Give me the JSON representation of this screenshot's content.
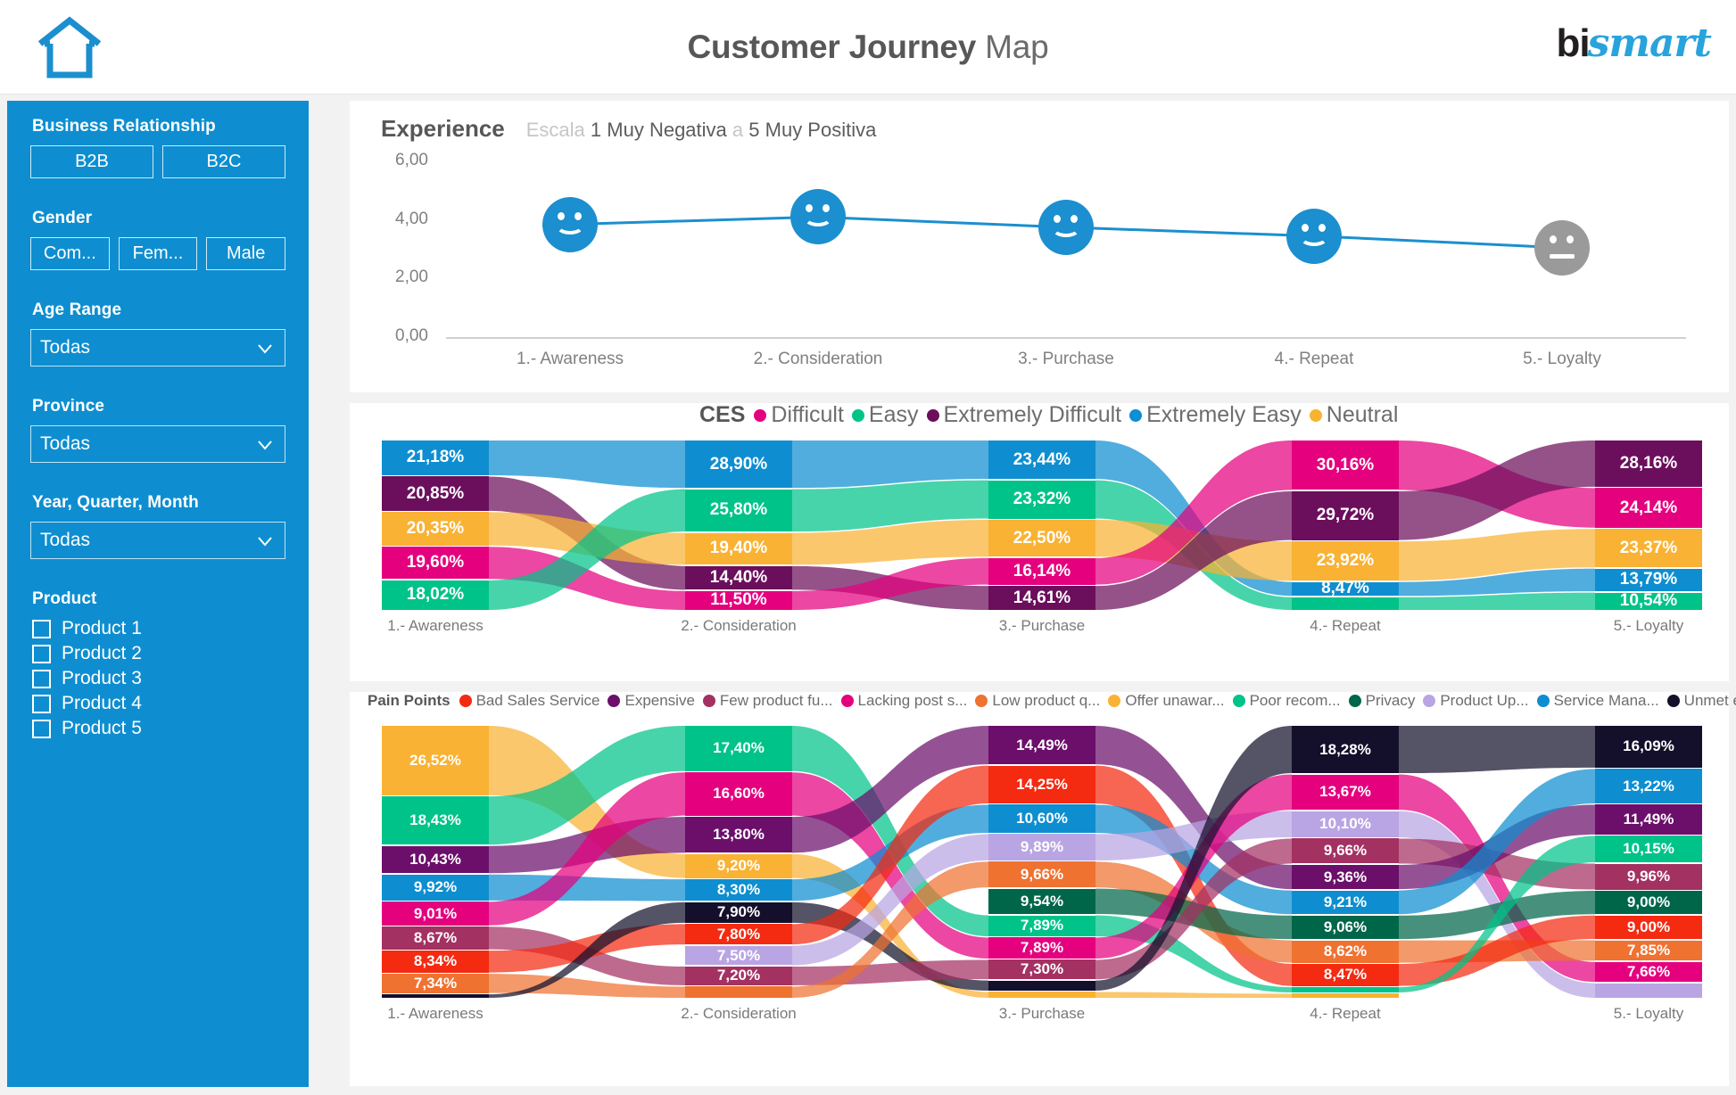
{
  "header": {
    "title_bold": "Customer Journey",
    "title_light": "Map",
    "home_icon": "home-icon",
    "logo_bi": "bi",
    "logo_smart": "smart"
  },
  "sidebar": {
    "business_relationship": {
      "label": "Business Relationship",
      "options": [
        "B2B",
        "B2C"
      ]
    },
    "gender": {
      "label": "Gender",
      "options": [
        "Com...",
        "Fem...",
        "Male"
      ]
    },
    "age_range": {
      "label": "Age Range",
      "value": "Todas",
      "chevron": "chevron-down-icon"
    },
    "province": {
      "label": "Province",
      "value": "Todas",
      "chevron": "chevron-down-icon"
    },
    "year_quarter_month": {
      "label": "Year, Quarter, Month",
      "value": "Todas",
      "chevron": "chevron-down-icon"
    },
    "product": {
      "label": "Product",
      "options": [
        "Product 1",
        "Product 2",
        "Product 3",
        "Product 4",
        "Product 5"
      ]
    }
  },
  "experience_card": {
    "title": "Experience",
    "sub_dim1": "Escala",
    "sub_1": "1 Muy Negativa",
    "sub_dim2": "a",
    "sub_2": "5 Muy Positiva"
  },
  "ces_card": {
    "legend_title": "CES"
  },
  "pain_card": {
    "legend_title": "Pain Points"
  },
  "chart_data": [
    {
      "type": "line",
      "title": "Experience",
      "subtitle": "Escala 1 Muy Negativa a 5 Muy Positiva",
      "categories": [
        "1.- Awareness",
        "2.- Consideration",
        "3.- Purchase",
        "4.- Repeat",
        "5.- Loyalty"
      ],
      "values": [
        3.85,
        4.1,
        3.75,
        3.45,
        3.05
      ],
      "ylim": [
        0,
        6
      ],
      "yticks": [
        "0,00",
        "2,00",
        "4,00",
        "6,00"
      ],
      "ylabel": "",
      "xlabel": "",
      "grid": false,
      "series_color": "#1b8fcf",
      "markers": [
        "smile",
        "smile",
        "smile",
        "smile",
        "neutral"
      ],
      "marker_colors": [
        "#1b8fcf",
        "#1b8fcf",
        "#1b8fcf",
        "#1b8fcf",
        "#9a9a9a"
      ]
    },
    {
      "type": "sankey",
      "title": "CES",
      "legend": [
        {
          "label": "Difficult",
          "color": "#e5007e"
        },
        {
          "label": "Easy",
          "color": "#00c389"
        },
        {
          "label": "Extremely Difficult",
          "color": "#6b0f5c"
        },
        {
          "label": "Extremely Easy",
          "color": "#0e8ed0"
        },
        {
          "label": "Neutral",
          "color": "#f9b233"
        }
      ],
      "stages": [
        "1.- Awareness",
        "2.- Consideration",
        "3.- Purchase",
        "4.- Repeat",
        "5.- Loyalty"
      ],
      "columns": [
        [
          {
            "label": "21,18%",
            "value": 21.18,
            "cat": "Extremely Easy",
            "color": "#0e8ed0"
          },
          {
            "label": "20,85%",
            "value": 20.85,
            "cat": "Extremely Difficult",
            "color": "#6b0f5c"
          },
          {
            "label": "20,35%",
            "value": 20.35,
            "cat": "Neutral",
            "color": "#f9b233"
          },
          {
            "label": "19,60%",
            "value": 19.6,
            "cat": "Difficult",
            "color": "#e5007e"
          },
          {
            "label": "18,02%",
            "value": 18.02,
            "cat": "Easy",
            "color": "#00c389"
          }
        ],
        [
          {
            "label": "28,90%",
            "value": 28.9,
            "cat": "Extremely Easy",
            "color": "#0e8ed0"
          },
          {
            "label": "25,80%",
            "value": 25.8,
            "cat": "Easy",
            "color": "#00c389"
          },
          {
            "label": "19,40%",
            "value": 19.4,
            "cat": "Neutral",
            "color": "#f9b233"
          },
          {
            "label": "14,40%",
            "value": 14.4,
            "cat": "Extremely Difficult",
            "color": "#6b0f5c"
          },
          {
            "label": "11,50%",
            "value": 11.5,
            "cat": "Difficult",
            "color": "#e5007e"
          }
        ],
        [
          {
            "label": "23,44%",
            "value": 23.44,
            "cat": "Extremely Easy",
            "color": "#0e8ed0"
          },
          {
            "label": "23,32%",
            "value": 23.32,
            "cat": "Easy",
            "color": "#00c389"
          },
          {
            "label": "22,50%",
            "value": 22.5,
            "cat": "Neutral",
            "color": "#f9b233"
          },
          {
            "label": "16,14%",
            "value": 16.14,
            "cat": "Difficult",
            "color": "#e5007e"
          },
          {
            "label": "14,61%",
            "value": 14.61,
            "cat": "Extremely Difficult",
            "color": "#6b0f5c"
          }
        ],
        [
          {
            "label": "30,16%",
            "value": 30.16,
            "cat": "Difficult",
            "color": "#e5007e"
          },
          {
            "label": "29,72%",
            "value": 29.72,
            "cat": "Extremely Difficult",
            "color": "#6b0f5c"
          },
          {
            "label": "23,92%",
            "value": 23.92,
            "cat": "Neutral",
            "color": "#f9b233"
          },
          {
            "label": "8,47%",
            "value": 8.47,
            "cat": "Extremely Easy",
            "color": "#0e8ed0"
          },
          {
            "label": "",
            "value": 7.73,
            "cat": "Easy",
            "color": "#00c389"
          }
        ],
        [
          {
            "label": "28,16%",
            "value": 28.16,
            "cat": "Extremely Difficult",
            "color": "#6b0f5c"
          },
          {
            "label": "24,14%",
            "value": 24.14,
            "cat": "Difficult",
            "color": "#e5007e"
          },
          {
            "label": "23,37%",
            "value": 23.37,
            "cat": "Neutral",
            "color": "#f9b233"
          },
          {
            "label": "13,79%",
            "value": 13.79,
            "cat": "Extremely Easy",
            "color": "#0e8ed0"
          },
          {
            "label": "10,54%",
            "value": 10.54,
            "cat": "Easy",
            "color": "#00c389"
          }
        ]
      ]
    },
    {
      "type": "sankey",
      "title": "Pain Points",
      "legend": [
        {
          "label": "Bad Sales Service",
          "color": "#f42a11"
        },
        {
          "label": "Expensive",
          "color": "#6b0f6b"
        },
        {
          "label": "Few product fu...",
          "color": "#a33162"
        },
        {
          "label": "Lacking post s...",
          "color": "#e5007e"
        },
        {
          "label": "Low product q...",
          "color": "#ef7231"
        },
        {
          "label": "Offer unawar...",
          "color": "#f9b233"
        },
        {
          "label": "Poor recom...",
          "color": "#00c389"
        },
        {
          "label": "Privacy",
          "color": "#00664a"
        },
        {
          "label": "Product Up...",
          "color": "#b9a5e3"
        },
        {
          "label": "Service Mana...",
          "color": "#0e8ed0"
        },
        {
          "label": "Unmet expect...",
          "color": "#14102b"
        }
      ],
      "stages": [
        "1.- Awareness",
        "2.- Consideration",
        "3.- Purchase",
        "4.- Repeat",
        "5.- Loyalty"
      ],
      "columns": [
        [
          {
            "label": "26,52%",
            "value": 26.52,
            "cat": "Offer unawar...",
            "color": "#f9b233"
          },
          {
            "label": "18,43%",
            "value": 18.43,
            "cat": "Poor recom...",
            "color": "#00c389"
          },
          {
            "label": "10,43%",
            "value": 10.43,
            "cat": "Expensive",
            "color": "#6b0f6b"
          },
          {
            "label": "9,92%",
            "value": 9.92,
            "cat": "Service Mana...",
            "color": "#0e8ed0"
          },
          {
            "label": "9,01%",
            "value": 9.01,
            "cat": "Lacking post s...",
            "color": "#e5007e"
          },
          {
            "label": "8,67%",
            "value": 8.67,
            "cat": "Few product fu...",
            "color": "#a33162"
          },
          {
            "label": "8,34%",
            "value": 8.34,
            "cat": "Bad Sales Service",
            "color": "#f42a11"
          },
          {
            "label": "7,34%",
            "value": 7.34,
            "cat": "Low product q...",
            "color": "#ef7231"
          },
          {
            "label": "",
            "value": 1.34,
            "cat": "Unmet expect...",
            "color": "#14102b"
          }
        ],
        [
          {
            "label": "17,40%",
            "value": 17.4,
            "cat": "Poor recom...",
            "color": "#00c389"
          },
          {
            "label": "16,60%",
            "value": 16.6,
            "cat": "Lacking post s...",
            "color": "#e5007e"
          },
          {
            "label": "13,80%",
            "value": 13.8,
            "cat": "Expensive",
            "color": "#6b0f6b"
          },
          {
            "label": "9,20%",
            "value": 9.2,
            "cat": "Offer unawar...",
            "color": "#f9b233"
          },
          {
            "label": "8,30%",
            "value": 8.3,
            "cat": "Service Mana...",
            "color": "#0e8ed0"
          },
          {
            "label": "7,90%",
            "value": 7.9,
            "cat": "Unmet expect...",
            "color": "#14102b"
          },
          {
            "label": "7,80%",
            "value": 7.8,
            "cat": "Bad Sales Service",
            "color": "#f42a11"
          },
          {
            "label": "7,50%",
            "value": 7.5,
            "cat": "Product Up...",
            "color": "#b9a5e3"
          },
          {
            "label": "7,20%",
            "value": 7.2,
            "cat": "Few product fu...",
            "color": "#a33162"
          },
          {
            "label": "",
            "value": 4.3,
            "cat": "Low product q...",
            "color": "#ef7231"
          }
        ],
        [
          {
            "label": "14,49%",
            "value": 14.49,
            "cat": "Expensive",
            "color": "#6b0f6b"
          },
          {
            "label": "14,25%",
            "value": 14.25,
            "cat": "Bad Sales Service",
            "color": "#f42a11"
          },
          {
            "label": "10,60%",
            "value": 10.6,
            "cat": "Service Mana...",
            "color": "#0e8ed0"
          },
          {
            "label": "9,89%",
            "value": 9.89,
            "cat": "Product Up...",
            "color": "#b9a5e3"
          },
          {
            "label": "9,66%",
            "value": 9.66,
            "cat": "Low product q...",
            "color": "#ef7231"
          },
          {
            "label": "9,54%",
            "value": 9.54,
            "cat": "Privacy",
            "color": "#00664a"
          },
          {
            "label": "7,89%",
            "value": 7.89,
            "cat": "Poor recom...",
            "color": "#00c389"
          },
          {
            "label": "7,89%",
            "value": 7.89,
            "cat": "Lacking post s...",
            "color": "#e5007e"
          },
          {
            "label": "7,30%",
            "value": 7.3,
            "cat": "Few product fu...",
            "color": "#a33162"
          },
          {
            "label": "",
            "value": 3.8,
            "cat": "Unmet expect...",
            "color": "#14102b"
          },
          {
            "label": "",
            "value": 2.2,
            "cat": "Offer unawar...",
            "color": "#f9b233"
          }
        ],
        [
          {
            "label": "18,28%",
            "value": 18.28,
            "cat": "Unmet expect...",
            "color": "#14102b"
          },
          {
            "label": "13,67%",
            "value": 13.67,
            "cat": "Lacking post s...",
            "color": "#e5007e"
          },
          {
            "label": "10,10%",
            "value": 10.1,
            "cat": "Product Up...",
            "color": "#b9a5e3"
          },
          {
            "label": "9,66%",
            "value": 9.66,
            "cat": "Few product fu...",
            "color": "#a33162"
          },
          {
            "label": "9,36%",
            "value": 9.36,
            "cat": "Expensive",
            "color": "#6b0f6b"
          },
          {
            "label": "9,21%",
            "value": 9.21,
            "cat": "Service Mana...",
            "color": "#0e8ed0"
          },
          {
            "label": "9,06%",
            "value": 9.06,
            "cat": "Privacy",
            "color": "#00664a"
          },
          {
            "label": "8,62%",
            "value": 8.62,
            "cat": "Low product q...",
            "color": "#ef7231"
          },
          {
            "label": "8,47%",
            "value": 8.47,
            "cat": "Bad Sales Service",
            "color": "#f42a11"
          },
          {
            "label": "",
            "value": 2.0,
            "cat": "Poor recom...",
            "color": "#00c389"
          },
          {
            "label": "",
            "value": 1.57,
            "cat": "Offer unawar...",
            "color": "#f9b233"
          }
        ],
        [
          {
            "label": "16,09%",
            "value": 16.09,
            "cat": "Unmet expect...",
            "color": "#14102b"
          },
          {
            "label": "13,22%",
            "value": 13.22,
            "cat": "Service Mana...",
            "color": "#0e8ed0"
          },
          {
            "label": "11,49%",
            "value": 11.49,
            "cat": "Expensive",
            "color": "#6b0f6b"
          },
          {
            "label": "10,15%",
            "value": 10.15,
            "cat": "Poor recom...",
            "color": "#00c389"
          },
          {
            "label": "9,96%",
            "value": 9.96,
            "cat": "Few product fu...",
            "color": "#a33162"
          },
          {
            "label": "9,00%",
            "value": 9.0,
            "cat": "Privacy",
            "color": "#00664a"
          },
          {
            "label": "9,00%",
            "value": 9.0,
            "cat": "Bad Sales Service",
            "color": "#f42a11"
          },
          {
            "label": "7,85%",
            "value": 7.85,
            "cat": "Low product q...",
            "color": "#ef7231"
          },
          {
            "label": "7,66%",
            "value": 7.66,
            "cat": "Lacking post s...",
            "color": "#e5007e"
          },
          {
            "label": "",
            "value": 5.58,
            "cat": "Product Up...",
            "color": "#b9a5e3"
          }
        ]
      ]
    }
  ]
}
